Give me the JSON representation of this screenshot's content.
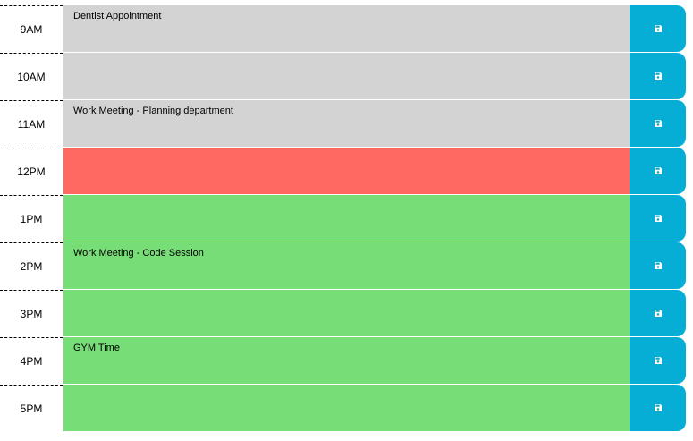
{
  "rows": [
    {
      "hour": "9AM",
      "text": "Dentist Appointment",
      "state": "past"
    },
    {
      "hour": "10AM",
      "text": "",
      "state": "past"
    },
    {
      "hour": "11AM",
      "text": "Work Meeting - Planning department",
      "state": "past"
    },
    {
      "hour": "12PM",
      "text": "",
      "state": "present"
    },
    {
      "hour": "1PM",
      "text": "",
      "state": "future"
    },
    {
      "hour": "2PM",
      "text": "Work Meeting - Code Session",
      "state": "future"
    },
    {
      "hour": "3PM",
      "text": "",
      "state": "future"
    },
    {
      "hour": "4PM",
      "text": "GYM Time",
      "state": "future"
    },
    {
      "hour": "5PM",
      "text": "",
      "state": "future"
    }
  ],
  "save_icon": "floppy-disk-icon",
  "colors": {
    "past": "#d3d3d3",
    "present": "#ff6961",
    "future": "#77dd77",
    "save_button": "#06aed5"
  }
}
